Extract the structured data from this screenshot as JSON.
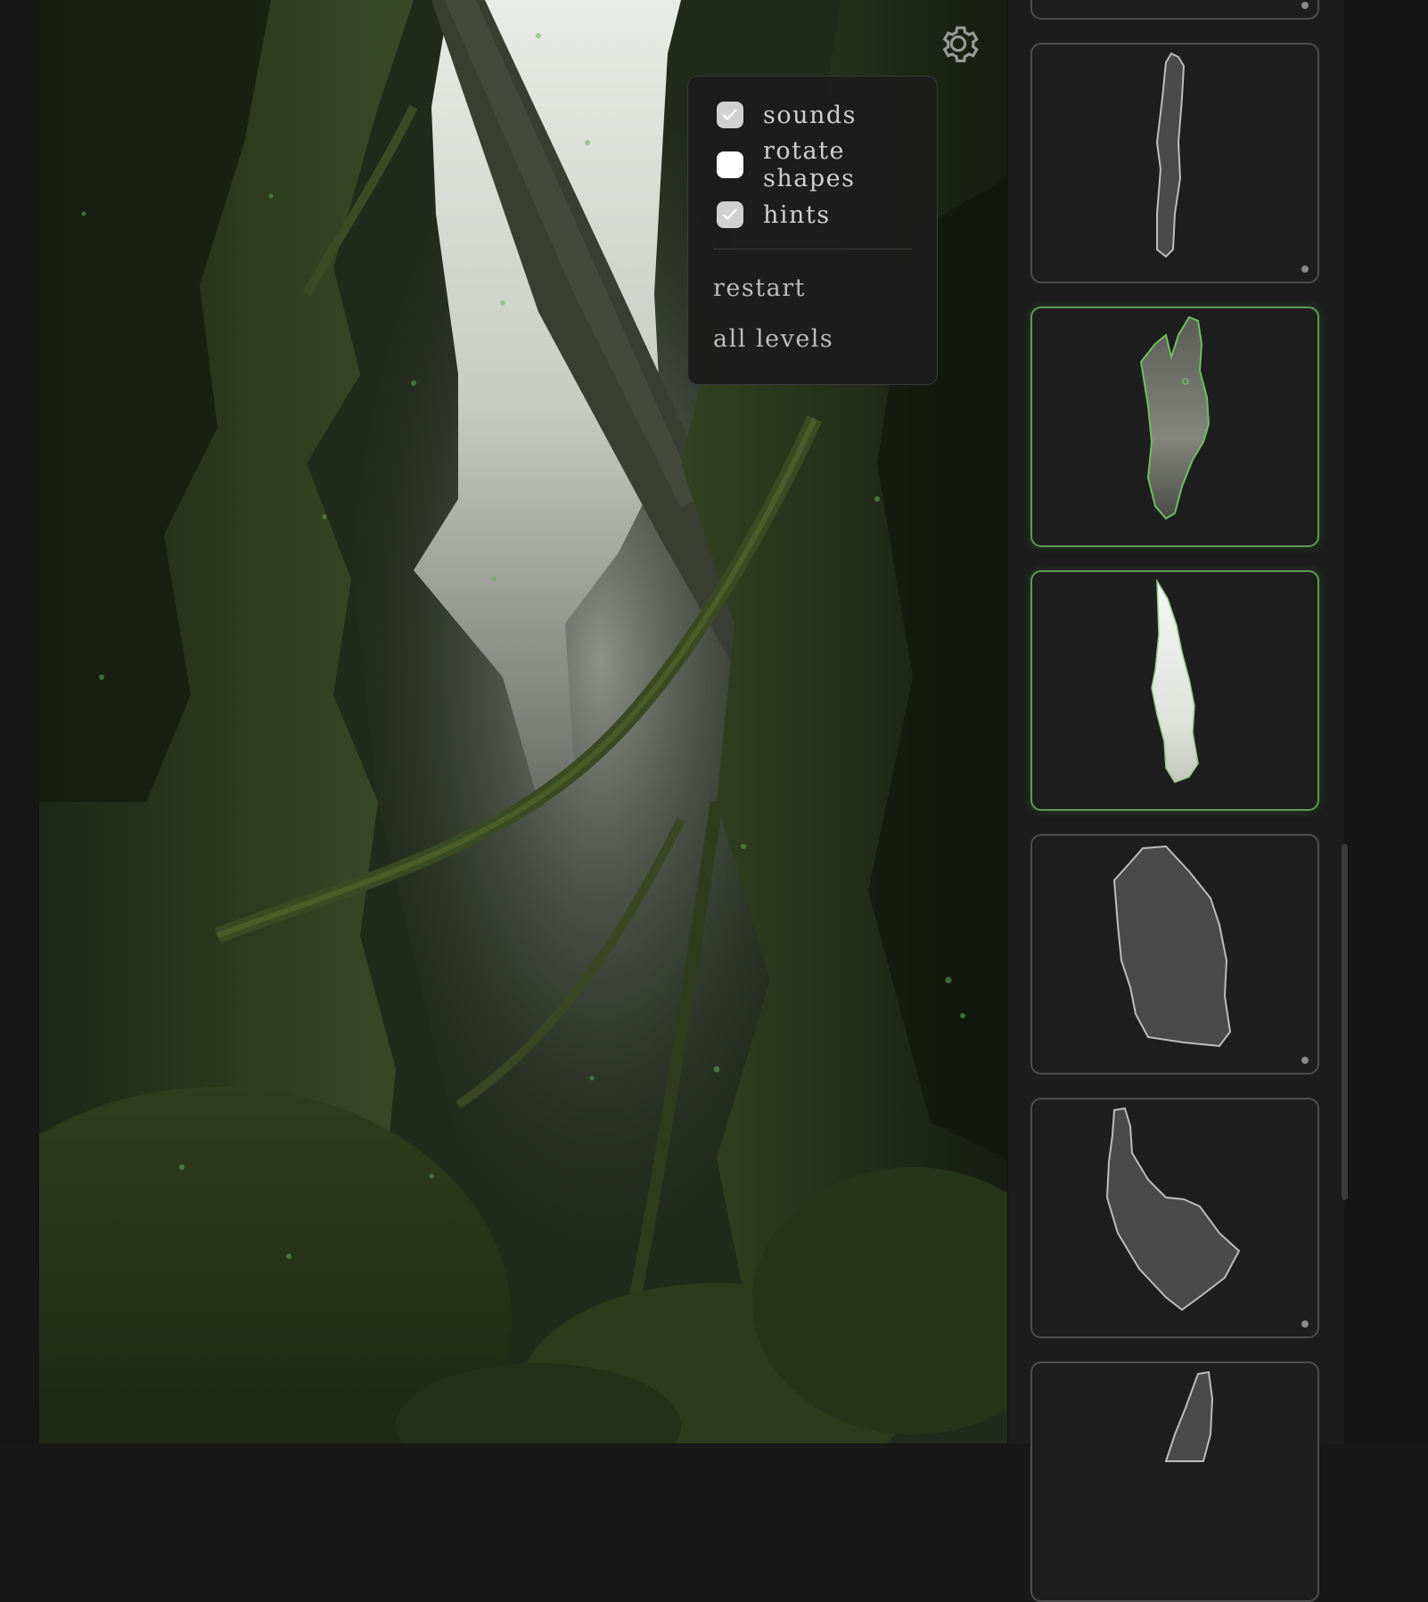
{
  "settings_menu": {
    "options": [
      {
        "label": "sounds",
        "checked": true
      },
      {
        "label": "rotate shapes",
        "checked": false
      },
      {
        "label": "hints",
        "checked": true
      }
    ],
    "restart_label": "restart",
    "all_levels_label": "all levels"
  },
  "icons": {
    "settings": "gear-icon",
    "check": "checkmark-icon"
  },
  "tray": {
    "pieces": [
      {
        "state": "unplaced"
      },
      {
        "state": "unplaced"
      },
      {
        "state": "placed"
      },
      {
        "state": "placed"
      },
      {
        "state": "unplaced"
      },
      {
        "state": "unplaced"
      },
      {
        "state": "unplaced"
      }
    ]
  },
  "colors": {
    "accent_green": "#5d9a55",
    "panel_bg": "#1c1c1c",
    "tray_bg": "#1d1d1d",
    "piece_fill": "#4a4a4a",
    "piece_outline": "#bdbdbd"
  }
}
